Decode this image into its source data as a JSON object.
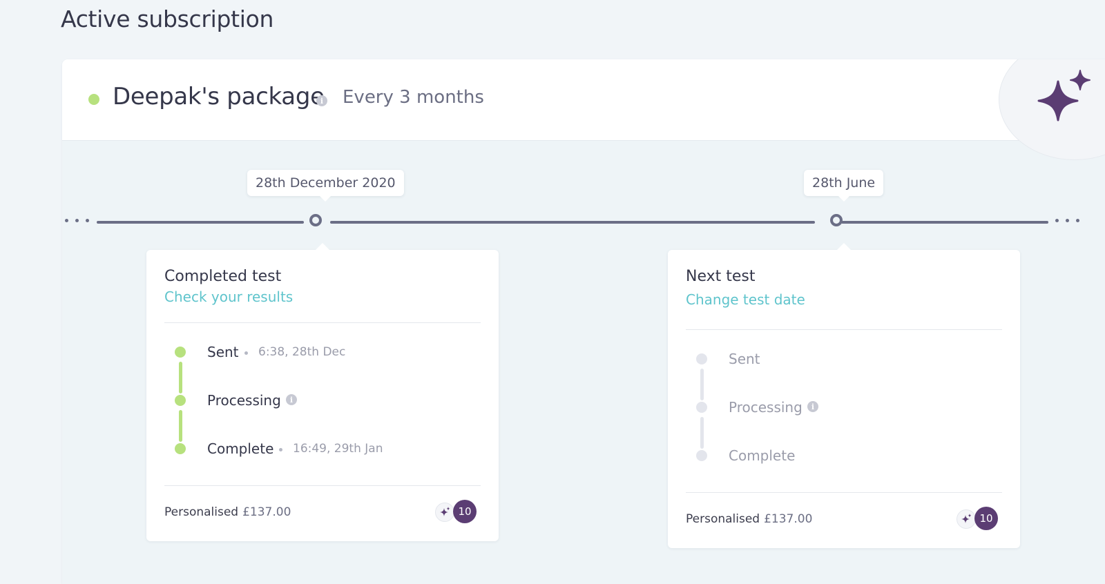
{
  "page": {
    "title": "Active subscription"
  },
  "package": {
    "name": "Deepak's package",
    "frequency": "Every 3 months",
    "status_color": "#b7e17e",
    "info_icon": "info-icon",
    "badge_icon": "sparkle-icon",
    "brand_color": "#5b3d73"
  },
  "timeline": {
    "dates": [
      "28th December 2020",
      "28th June"
    ]
  },
  "completed_test": {
    "title": "Completed test",
    "link": "Check your results",
    "steps": [
      {
        "label": "Sent",
        "time": "6:38, 28th Dec"
      },
      {
        "label": "Processing",
        "info_icon": "info-icon"
      },
      {
        "label": "Complete",
        "time": "16:49, 29th Jan"
      }
    ],
    "footer": {
      "label": "Personalised",
      "price": "£137.00",
      "credits": "10"
    },
    "step_color": "#b7e17e"
  },
  "next_test": {
    "title": "Next test",
    "link": "Change test date",
    "steps": [
      {
        "label": "Sent"
      },
      {
        "label": "Processing",
        "info_icon": "info-icon"
      },
      {
        "label": "Complete"
      }
    ],
    "footer": {
      "label": "Personalised",
      "price": "£137.00",
      "credits": "10"
    },
    "step_color": "#e3e5ec"
  }
}
